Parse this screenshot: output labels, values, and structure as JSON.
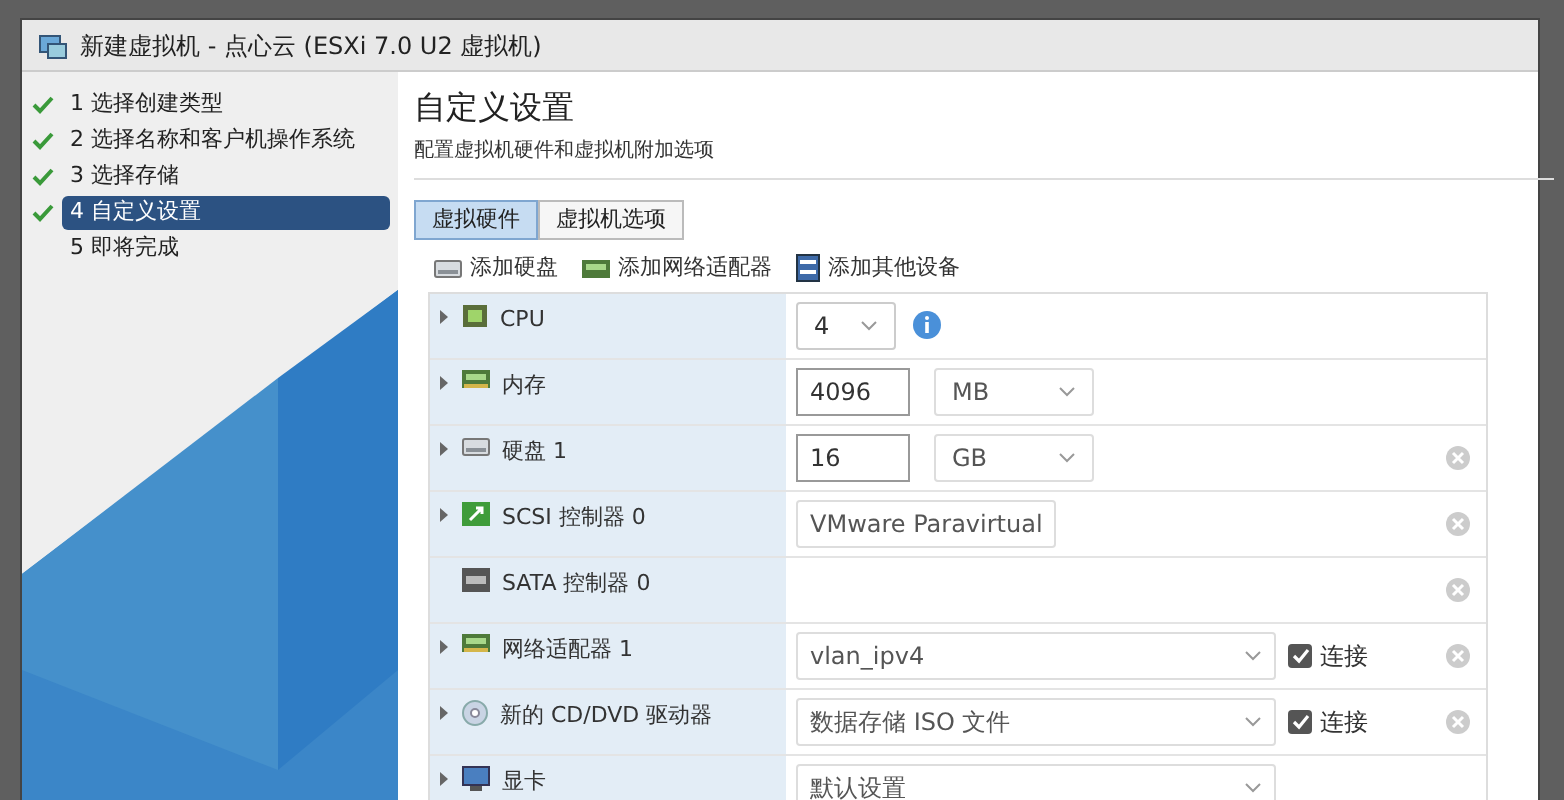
{
  "window": {
    "title": "新建虚拟机 - 点心云 (ESXi 7.0 U2 虚拟机)"
  },
  "steps": [
    {
      "label": "1 选择创建类型",
      "done": true,
      "selected": false
    },
    {
      "label": "2 选择名称和客户机操作系统",
      "done": true,
      "selected": false
    },
    {
      "label": "3 选择存储",
      "done": true,
      "selected": false
    },
    {
      "label": "4 自定义设置",
      "done": true,
      "selected": true
    },
    {
      "label": "5 即将完成",
      "done": false,
      "selected": false
    }
  ],
  "page": {
    "title": "自定义设置",
    "subtitle": "配置虚拟机硬件和虚拟机附加选项"
  },
  "tabs": [
    {
      "label": "虚拟硬件",
      "selected": true
    },
    {
      "label": "虚拟机选项",
      "selected": false
    }
  ],
  "toolbar": [
    {
      "label": "添加硬盘",
      "kind": "disk"
    },
    {
      "label": "添加网络适配器",
      "kind": "nic"
    },
    {
      "label": "添加其他设备",
      "kind": "device"
    }
  ],
  "hardware": [
    {
      "label": "CPU",
      "kind": "cpu",
      "expandable": true,
      "value": "4",
      "info": true,
      "removable": false
    },
    {
      "label": "内存",
      "kind": "memory",
      "expandable": true,
      "value": "4096",
      "unit": "MB",
      "removable": false
    },
    {
      "label": "硬盘 1",
      "kind": "disk",
      "expandable": true,
      "value": "16",
      "unit": "GB",
      "removable": true
    },
    {
      "label": "SCSI 控制器 0",
      "kind": "scsi",
      "expandable": true,
      "value": "VMware Paravirtual",
      "removable": true
    },
    {
      "label": "SATA 控制器 0",
      "kind": "sata",
      "expandable": false,
      "removable": true
    },
    {
      "label": "网络适配器 1",
      "kind": "nic",
      "expandable": true,
      "value": "vlan_ipv4",
      "connect_label": "连接",
      "connected": true,
      "removable": true
    },
    {
      "label": "新的 CD/DVD 驱动器",
      "kind": "cd",
      "expandable": true,
      "value": "数据存储 ISO 文件",
      "connect_label": "连接",
      "connected": true,
      "removable": true
    },
    {
      "label": "显卡",
      "kind": "display",
      "expandable": true,
      "value": "默认设置",
      "removable": false
    }
  ]
}
